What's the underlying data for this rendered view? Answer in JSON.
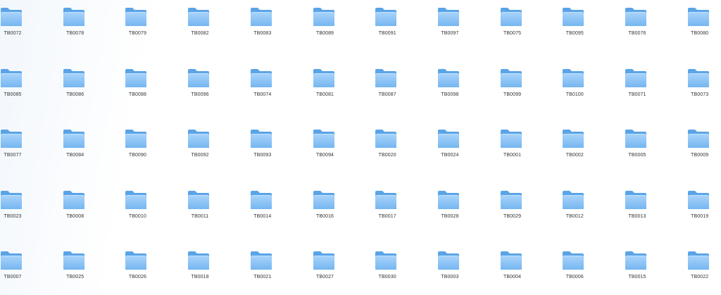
{
  "explorer": {
    "colors": {
      "folder_back": "#5aa4e6",
      "folder_front_top": "#a9d4fb",
      "folder_front_bottom": "#75b6f0",
      "label_text": "#333333"
    },
    "icon": "folder-icon",
    "folders": [
      "TB0072",
      "TB0078",
      "TB0079",
      "TB0082",
      "TB0083",
      "TB0089",
      "TB0091",
      "TB0097",
      "TB0075",
      "TB0095",
      "TB0076",
      "TB0080",
      "TB0085",
      "TB0086",
      "TB0088",
      "TB0096",
      "TB0074",
      "TB0081",
      "TB0087",
      "TB0098",
      "TB0099",
      "TB0100",
      "TB0071",
      "TB0073",
      "TB0077",
      "TB0084",
      "TB0090",
      "TB0092",
      "TB0093",
      "TB0094",
      "TB0020",
      "TB0024",
      "TB0001",
      "TB0002",
      "TB0005",
      "TB0009",
      "TB0023",
      "TB0008",
      "TB0010",
      "TB0011",
      "TB0014",
      "TB0016",
      "TB0017",
      "TB0028",
      "TB0029",
      "TB0012",
      "TB0013",
      "TB0019",
      "TB0007",
      "TB0025",
      "TB0026",
      "TB0018",
      "TB0021",
      "TB0027",
      "TB0030",
      "TB0003",
      "TB0004",
      "TB0006",
      "TB0015",
      "TB0022"
    ]
  }
}
